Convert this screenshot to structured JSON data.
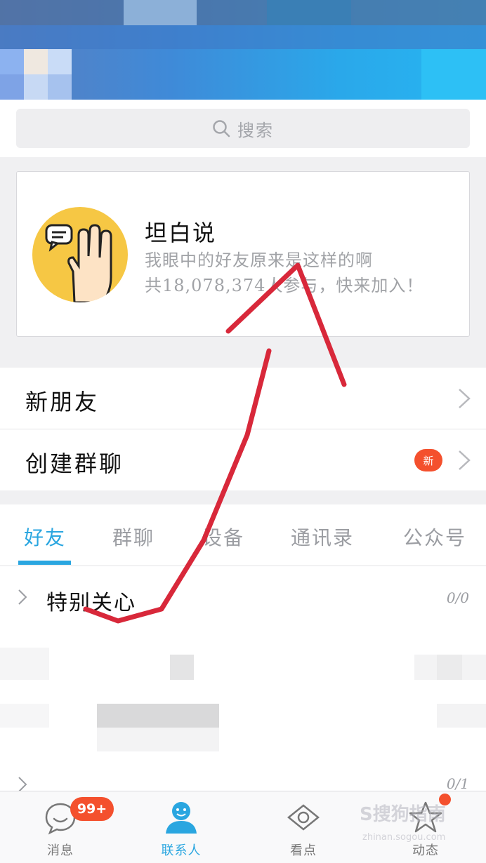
{
  "search": {
    "placeholder": "搜索"
  },
  "promo_card": {
    "title": "坦白说",
    "subtitle_line1": "我眼中的好友原来是这样的啊",
    "subtitle_line2": "共18,078,374人参与，快来加入！"
  },
  "menu": {
    "new_friends": "新朋友",
    "create_group": "创建群聊",
    "new_badge": "新"
  },
  "tabs": [
    {
      "label": "好友",
      "active": true
    },
    {
      "label": "群聊",
      "active": false
    },
    {
      "label": "设备",
      "active": false
    },
    {
      "label": "通讯录",
      "active": false
    },
    {
      "label": "公众号",
      "active": false
    }
  ],
  "groups": [
    {
      "name": "特别关心",
      "count": "0/0"
    },
    {
      "name": "",
      "count": "0/1"
    }
  ],
  "bottom_nav": [
    {
      "label": "消息",
      "icon": "chat-bubble-icon",
      "active": false
    },
    {
      "label": "联系人",
      "icon": "contact-person-icon",
      "active": true
    },
    {
      "label": "看点",
      "icon": "eye-icon",
      "active": false
    },
    {
      "label": "动态",
      "icon": "star-icon",
      "active": false
    }
  ],
  "message_badge": "99+",
  "watermark": {
    "main": "S搜狗指南",
    "sub": "zhinan.sogou.com"
  },
  "colors": {
    "accent": "#2aa6e0",
    "badge": "#f4502d",
    "annotation": "#d8283a"
  }
}
